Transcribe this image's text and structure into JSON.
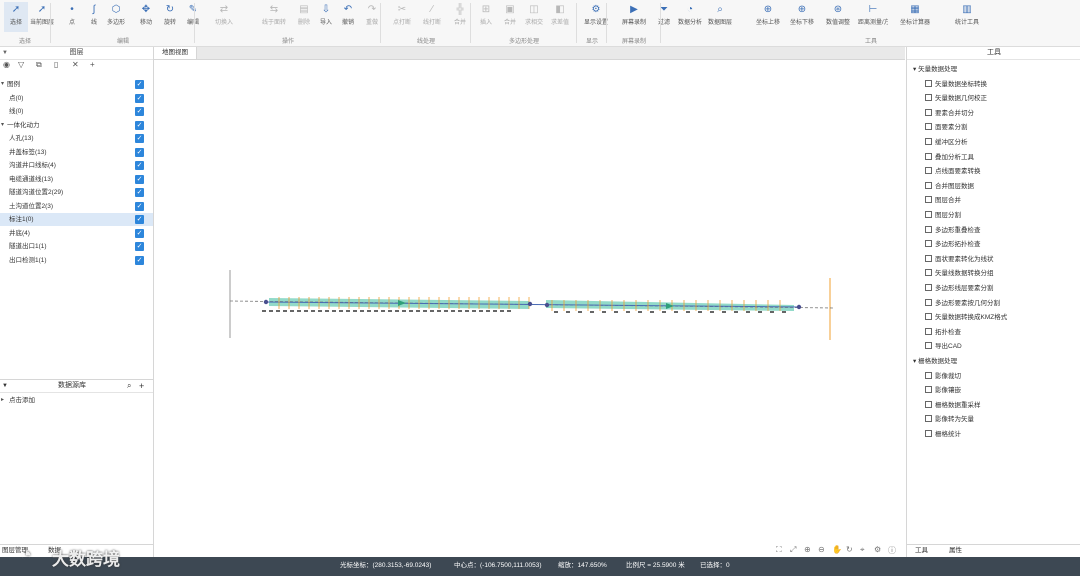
{
  "ribbon": {
    "buttons": [
      {
        "label": "选择",
        "icon": "pointer-icon",
        "enabled": true
      },
      {
        "label": "当前图层",
        "icon": "layer-pointer-icon",
        "enabled": true
      },
      {
        "label": "点",
        "icon": "point-icon",
        "enabled": true
      },
      {
        "label": "线",
        "icon": "line-icon",
        "enabled": true
      },
      {
        "label": "多边形",
        "icon": "polygon-icon",
        "enabled": true
      },
      {
        "label": "移动",
        "icon": "move-icon",
        "enabled": true
      },
      {
        "label": "旋转",
        "icon": "rotate-icon",
        "enabled": true
      },
      {
        "label": "编辑",
        "icon": "edit-icon",
        "enabled": true
      },
      {
        "label": "切换入",
        "icon": "switch-icon",
        "enabled": false
      },
      {
        "label": "线于面转换",
        "icon": "convert-icon",
        "enabled": false
      },
      {
        "label": "删除",
        "icon": "delete-icon",
        "enabled": false
      },
      {
        "label": "导入",
        "icon": "import-icon",
        "enabled": true
      },
      {
        "label": "撤销",
        "icon": "undo-icon",
        "enabled": true
      },
      {
        "label": "重做",
        "icon": "redo-icon",
        "enabled": false
      },
      {
        "label": "点打断",
        "icon": "point-break-icon",
        "enabled": false
      },
      {
        "label": "线打断",
        "icon": "line-break-icon",
        "enabled": false
      },
      {
        "label": "合并",
        "icon": "merge-icon",
        "enabled": false
      },
      {
        "label": "插入",
        "icon": "insert-icon",
        "enabled": false
      },
      {
        "label": "合并",
        "icon": "merge2-icon",
        "enabled": false
      },
      {
        "label": "求相交",
        "icon": "intersect-icon",
        "enabled": false
      },
      {
        "label": "求差值",
        "icon": "difference-icon",
        "enabled": false
      },
      {
        "label": "显示设置",
        "icon": "display-settings-icon",
        "enabled": true
      },
      {
        "label": "屏幕录制",
        "icon": "record-icon",
        "enabled": true
      },
      {
        "label": "过滤",
        "icon": "filter-icon",
        "enabled": true
      },
      {
        "label": "数据分析",
        "icon": "analysis-icon",
        "enabled": true
      },
      {
        "label": "数据图层检查",
        "icon": "layer-check-icon",
        "enabled": true
      },
      {
        "label": "坐标上移",
        "icon": "coord-up-icon",
        "enabled": true
      },
      {
        "label": "坐标下移",
        "icon": "coord-down-icon",
        "enabled": true
      },
      {
        "label": "数值调整",
        "icon": "adjust-icon",
        "enabled": true
      },
      {
        "label": "距离测量/方向",
        "icon": "measure-icon",
        "enabled": true
      },
      {
        "label": "坐标计算器",
        "icon": "calculator-icon",
        "enabled": true
      },
      {
        "label": "统计工具",
        "icon": "stats-icon",
        "enabled": true
      }
    ],
    "groups": [
      {
        "label": "选择"
      },
      {
        "label": "编辑"
      },
      {
        "label": "操作"
      },
      {
        "label": "线处理"
      },
      {
        "label": "多边形处理"
      },
      {
        "label": "显示"
      },
      {
        "label": "屏幕录制"
      },
      {
        "label": "工具"
      }
    ]
  },
  "layer_panel": {
    "title": "图层",
    "tree": [
      {
        "label": "图例",
        "level": 0,
        "expanded": true,
        "checked": true,
        "selected": false
      },
      {
        "label": "点(0)",
        "level": 1,
        "checked": true,
        "selected": false
      },
      {
        "label": "线(0)",
        "level": 1,
        "checked": true,
        "selected": false
      },
      {
        "label": "一体化动力",
        "level": 0,
        "expanded": true,
        "checked": true,
        "selected": false
      },
      {
        "label": "人孔(13)",
        "level": 1,
        "checked": true,
        "selected": false
      },
      {
        "label": "井盖标签(13)",
        "level": 1,
        "checked": true,
        "selected": false
      },
      {
        "label": "沟道井口线标(4)",
        "level": 1,
        "checked": true,
        "selected": false
      },
      {
        "label": "电缆通道线(13)",
        "level": 1,
        "checked": true,
        "selected": false
      },
      {
        "label": "隧道沟道位置2(29)",
        "level": 1,
        "checked": true,
        "selected": false
      },
      {
        "label": "土沟道位置2(3)",
        "level": 1,
        "checked": true,
        "selected": false
      },
      {
        "label": "标注1(0)",
        "level": 1,
        "checked": true,
        "selected": true
      },
      {
        "label": "井底(4)",
        "level": 1,
        "checked": true,
        "selected": false
      },
      {
        "label": "隧道出口1(1)",
        "level": 1,
        "checked": true,
        "selected": false
      },
      {
        "label": "出口检测1(1)",
        "level": 1,
        "checked": true,
        "selected": false
      }
    ]
  },
  "datasource_panel": {
    "title": "数据源库",
    "items": [
      {
        "label": "点击添加"
      }
    ]
  },
  "left_bottom_tabs": [
    "图层管理",
    "数据"
  ],
  "map_tab": "地图视图",
  "map_data": {
    "route_color": "#7fd3bf",
    "centerline_color": "#4a6bb5",
    "marker_color": "#f0a030",
    "nodes": 13
  },
  "right_panel": {
    "title": "工具",
    "sections": [
      {
        "label": "矢量数据处理",
        "items": [
          "矢量数据坐标转换",
          "矢量数据几何校正",
          "要素合并切分",
          "面要素分割",
          "缓冲区分析",
          "叠加分析工具",
          "点线面要素转换",
          "合并图层数据",
          "图层合并",
          "图层分割",
          "多边形重叠检查",
          "多边形拓扑检查",
          "面状要素转化为线状",
          "矢量线数据转换分组",
          "多边形线层要素分割",
          "多边形要素按几何分割",
          "矢量数据转换成KMZ格式",
          "拓扑检查",
          "导出CAD"
        ]
      },
      {
        "label": "栅格数据处理",
        "items": [
          "影像裁切",
          "影像镶嵌",
          "栅格数据重采样",
          "影像转为矢量",
          "栅格统计"
        ]
      }
    ],
    "tabs": [
      "工具",
      "属性"
    ]
  },
  "status_bar": {
    "cursor": "光标坐标：(280.3153,-69.0243)",
    "center": "中心点：(-106.7500,111.0053)",
    "scale": "缩放：147.650%",
    "ruler": "比例尺 = 25.5900 米",
    "selected": "已选择：0"
  },
  "watermark": "大数跨境"
}
